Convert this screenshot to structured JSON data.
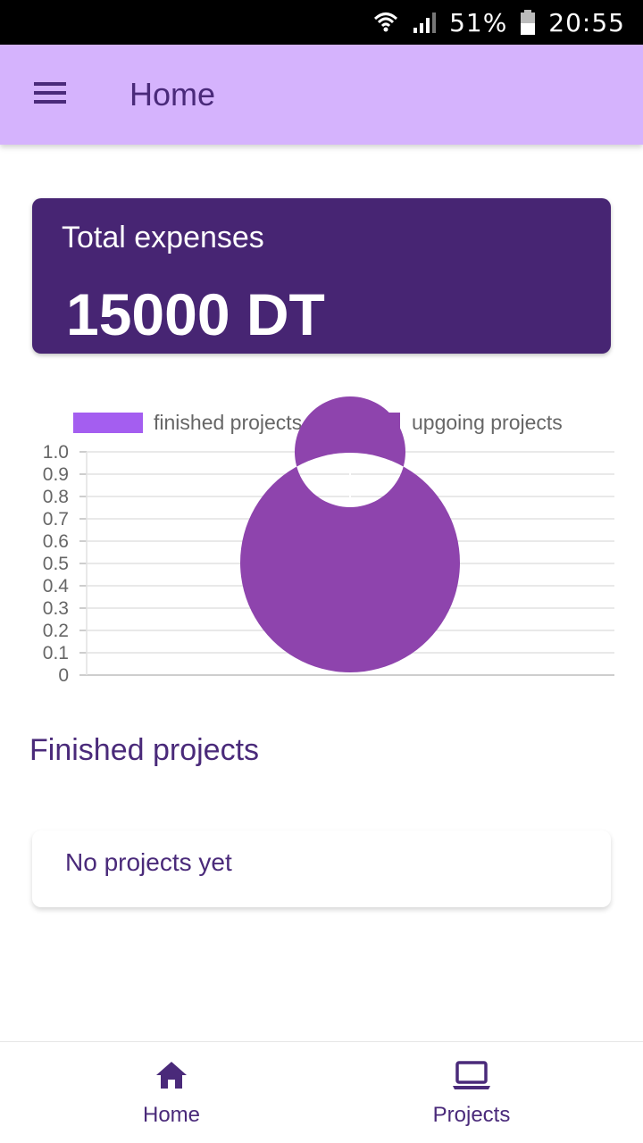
{
  "status_bar": {
    "battery": "51%",
    "time": "20:55",
    "icons": [
      "wifi-icon",
      "signal-icon",
      "battery-icon"
    ]
  },
  "app_bar": {
    "title": "Home",
    "menu_icon": "menu-icon"
  },
  "expenses": {
    "label": "Total expenses",
    "value": "15000 DT"
  },
  "chart_data": {
    "type": "pie",
    "donut": true,
    "legend": [
      "finished projects",
      "upgoing projects"
    ],
    "values": [
      0,
      1
    ],
    "colors": [
      "#a45ef0",
      "#8e44ad"
    ],
    "y_ticks": [
      "1.0",
      "0.9",
      "0.8",
      "0.7",
      "0.6",
      "0.5",
      "0.4",
      "0.3",
      "0.2",
      "0.1",
      "0"
    ],
    "ylim": [
      0,
      1
    ],
    "grid": true,
    "legend_position": "top"
  },
  "finished_section": {
    "title": "Finished projects",
    "empty_text": "No projects yet"
  },
  "bottom_nav": {
    "items": [
      {
        "label": "Home",
        "icon": "home-icon"
      },
      {
        "label": "Projects",
        "icon": "laptop-icon"
      }
    ]
  },
  "colors": {
    "app_bar": "#d5b3fd",
    "primary_dark": "#472573",
    "text_primary": "#4a2a7a"
  }
}
